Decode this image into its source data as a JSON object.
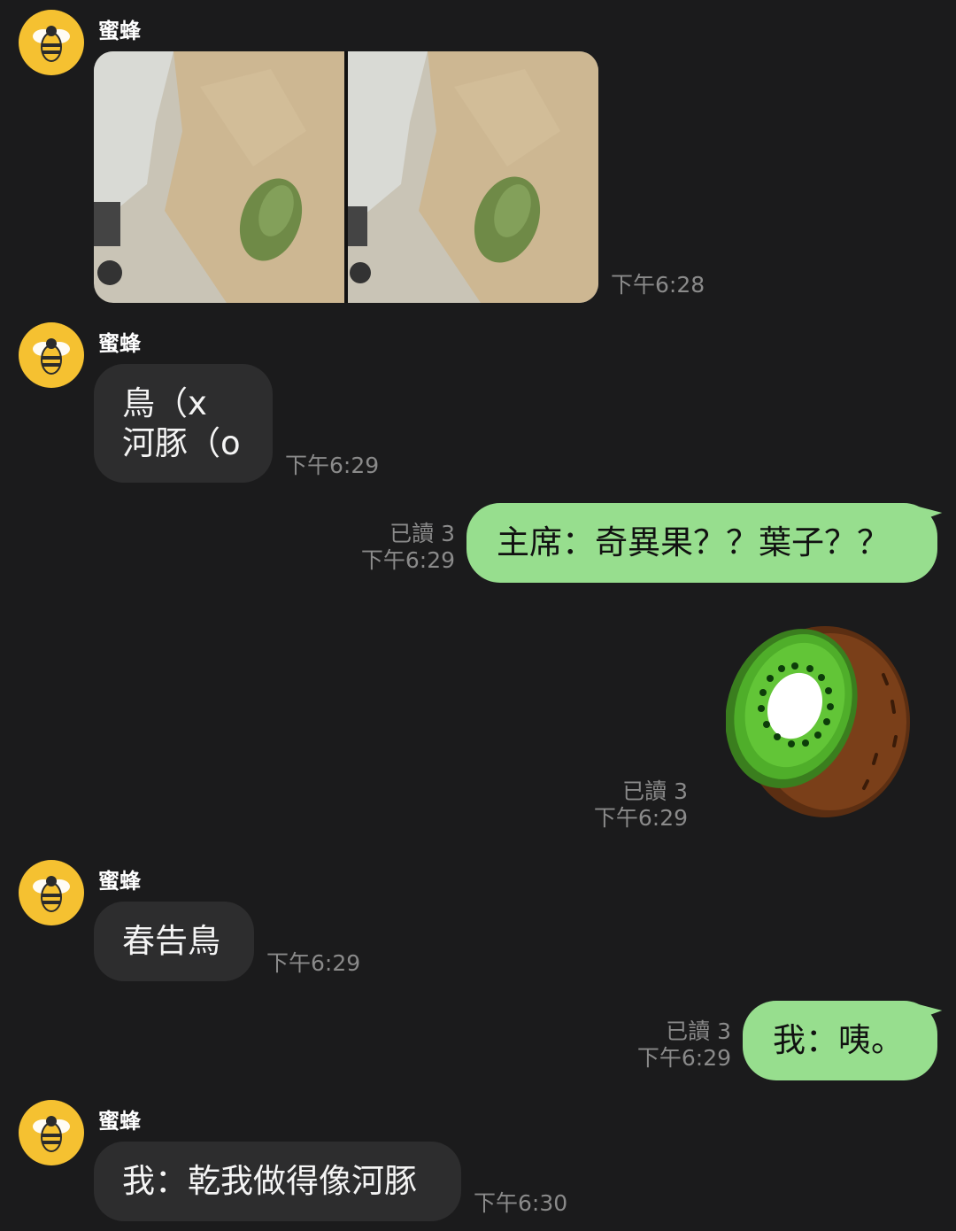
{
  "messages": [
    {
      "sender": "蜜蜂",
      "time": "下午6:28"
    },
    {
      "sender": "蜜蜂",
      "line1": "鳥（x",
      "line2": "河豚（o",
      "time": "下午6:29"
    },
    {
      "read": "已讀 3",
      "time": "下午6:29",
      "text": "主席：奇異果？？葉子？？"
    },
    {
      "read": "已讀 3",
      "time": "下午6:29",
      "sticker": "kiwi-sticker"
    },
    {
      "sender": "蜜蜂",
      "text": "春告鳥",
      "time": "下午6:29"
    },
    {
      "read": "已讀 3",
      "time": "下午6:29",
      "text": "我：咦。"
    },
    {
      "sender": "蜜蜂",
      "text": "我：乾我做得像河豚",
      "time": "下午6:30"
    }
  ],
  "colors": {
    "background": "#1b1b1c",
    "incoming_bubble": "#2d2d2e",
    "outgoing_bubble": "#97de8e",
    "avatar": "#f5c131",
    "meta_text": "#8a8a8a"
  }
}
